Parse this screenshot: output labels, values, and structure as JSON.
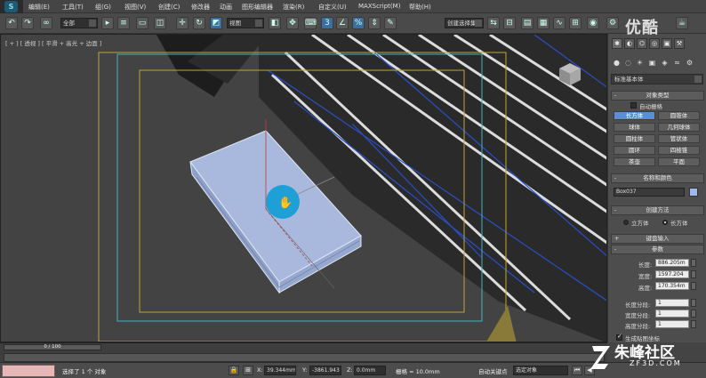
{
  "menu": {
    "items": [
      "编辑(E)",
      "工具(T)",
      "组(G)",
      "视图(V)",
      "创建(C)",
      "修改器",
      "动画",
      "图形编辑器",
      "渲染(R)",
      "自定义(U)",
      "MAXScript(M)",
      "帮助(H)"
    ]
  },
  "toolbar": {
    "filter_combo": "全部",
    "refcoord_combo": "视图",
    "selset_combo": "创建选择集"
  },
  "viewport": {
    "label": "[ + ] [ 透视 ] [ 平滑 + 高光 + 边面 ]",
    "colors": {
      "bg": "#434343",
      "box_top": "#a9b9de",
      "box_side": "#8fa0c8",
      "safe_frame_outer": "#c2a23a",
      "safe_frame_inner": "#3fb3c6",
      "cursor_highlight": "#1e9fd6",
      "wire_blue": "#2a4fc8"
    }
  },
  "cmdpanel": {
    "category_combo": "标准基本体",
    "object_type": {
      "title": "对象类型",
      "autogrid_label": "自动栅格",
      "buttons": [
        "长方体",
        "圆锥体",
        "球体",
        "几何球体",
        "圆柱体",
        "管状体",
        "圆环",
        "四棱锥",
        "茶壶",
        "平面"
      ],
      "active_index": 0
    },
    "name_color": {
      "title": "名称和颜色",
      "name_value": "Box037",
      "swatch": "#9fb8ec"
    },
    "creation_method": {
      "title": "创建方法",
      "options": [
        "立方体",
        "长方体"
      ],
      "selected_index": 1
    },
    "keyboard_entry": {
      "title": "键盘输入"
    },
    "parameters": {
      "title": "参数",
      "length_label": "长度:",
      "length_value": "886.205m",
      "width_label": "宽度:",
      "width_value": "1597.204",
      "height_label": "高度:",
      "height_value": "170.354m",
      "length_segs_label": "长度分段:",
      "length_segs_value": "1",
      "width_segs_label": "宽度分段:",
      "width_segs_value": "1",
      "height_segs_label": "高度分段:",
      "height_segs_value": "1",
      "gen_mapping_label": "生成贴图坐标"
    }
  },
  "timeline": {
    "slider_text": "0 / 100"
  },
  "status": {
    "selection_text": "选择了 1 个 对象",
    "x_label": "X:",
    "x_value": "39.344mm",
    "y_label": "Y:",
    "y_value": "-3861.943",
    "z_label": "Z:",
    "z_value": "0.0mm",
    "grid_text": "栅格 = 10.0mm",
    "autokey_text": "自动关键点",
    "selset_combo": "选定对象"
  },
  "watermarks": {
    "top_right": "优酷",
    "brand_name": "朱峰社区",
    "brand_url": "ZF3D.COM"
  }
}
